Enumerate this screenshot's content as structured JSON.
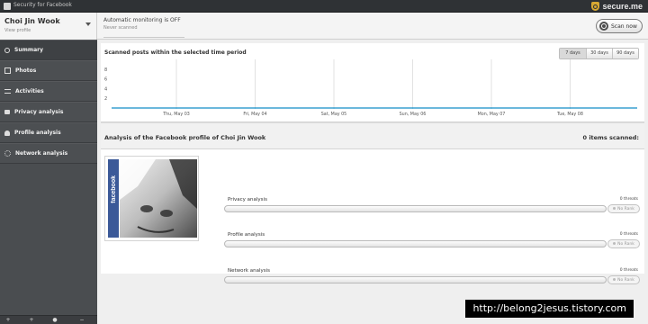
{
  "titlebar": {
    "title": "Security for Facebook"
  },
  "brand": {
    "name": "secure.me",
    "accent": "#d7a832"
  },
  "profile": {
    "name": "Choi Jin Wook",
    "sub": "View profile"
  },
  "monitor": {
    "status": "Automatic monitoring is OFF",
    "sub": "Never scanned"
  },
  "scan_button": {
    "label": "Scan now"
  },
  "sidebar": {
    "items": [
      {
        "label": "Summary",
        "icon": "search-icon"
      },
      {
        "label": "Photos",
        "icon": "photo-icon"
      },
      {
        "label": "Activities",
        "icon": "list-icon"
      },
      {
        "label": "Privacy analysis",
        "icon": "lock-icon"
      },
      {
        "label": "Profile analysis",
        "icon": "person-icon"
      },
      {
        "label": "Network analysis",
        "icon": "network-icon"
      }
    ]
  },
  "chart": {
    "title": "Scanned posts within the selected time period",
    "ranges": [
      "7 days",
      "30 days",
      "90 days"
    ],
    "selected_range": "7 days"
  },
  "chart_data": {
    "type": "line",
    "title": "Scanned posts within the selected time period",
    "xlabel": "",
    "ylabel": "",
    "categories": [
      "Thu, May 03",
      "Fri, May 04",
      "Sat, May 05",
      "Sun, May 06",
      "Mon, May 07",
      "Tue, May 08"
    ],
    "y_ticks": [
      2,
      4,
      6,
      8
    ],
    "ylim": [
      0,
      10
    ],
    "series": [
      {
        "values": [
          0,
          0,
          0,
          0,
          0,
          0
        ]
      }
    ],
    "grid": true,
    "line_color": "#3aa0d0"
  },
  "analysis": {
    "title": "Analysis of the Facebook profile of Choi Jin Wook",
    "items_scanned": "0 items scanned:",
    "photo_label": "facebook",
    "rows": [
      {
        "label": "Privacy analysis",
        "threats": "0 threats",
        "rank": "No Rank"
      },
      {
        "label": "Profile analysis",
        "threats": "0 threats",
        "rank": "No Rank"
      },
      {
        "label": "Network analysis",
        "threats": "0 threats",
        "rank": "No Rank"
      }
    ]
  },
  "watermark": {
    "text": "http://belong2jesus.tistory.com"
  }
}
